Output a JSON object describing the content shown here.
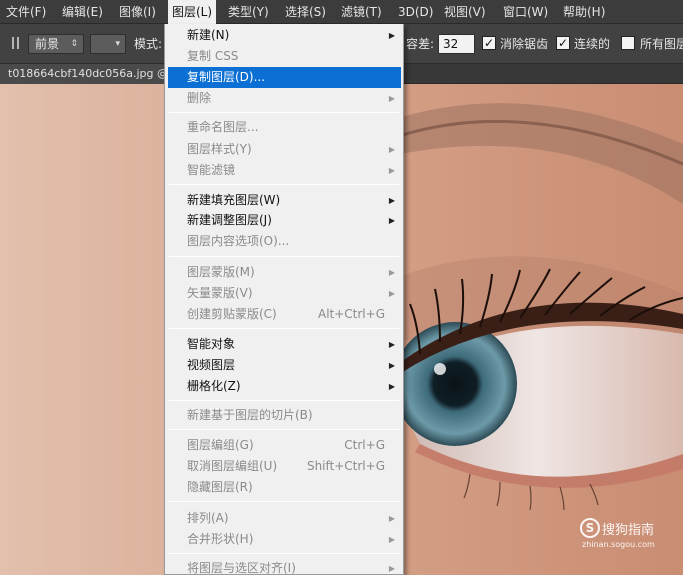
{
  "menubar": {
    "items": [
      "文件(F)",
      "编辑(E)",
      "图像(I)",
      "图层(L)",
      "类型(Y)",
      "选择(S)",
      "滤镜(T)",
      "3D(D)",
      "视图(V)",
      "窗口(W)",
      "帮助(H)"
    ]
  },
  "options": {
    "foreground": "前景",
    "swatch": "",
    "mode_label": "模式:",
    "tolerance_label": "容差:",
    "tolerance_value": "32",
    "antialias_label": "消除锯齿",
    "contiguous_label": "连续的",
    "all_layers_label": "所有图层"
  },
  "document": {
    "tab_title": "t018664cbf140dc056a.jpg @"
  },
  "layer_menu": {
    "new": "新建(N)",
    "copy_css": "复制 CSS",
    "duplicate_layer": "复制图层(D)...",
    "delete": "删除",
    "rename": "重命名图层...",
    "layer_style": "图层样式(Y)",
    "smart_filter": "智能滤镜",
    "new_fill": "新建填充图层(W)",
    "new_adjust": "新建调整图层(J)",
    "content_options": "图层内容选项(O)...",
    "layer_mask": "图层蒙版(M)",
    "vector_mask": "矢量蒙版(V)",
    "clipping_mask": "创建剪贴蒙版(C)",
    "clipping_mask_shortcut": "Alt+Ctrl+G",
    "smart_object": "智能对象",
    "video_layer": "视频图层",
    "rasterize": "栅格化(Z)",
    "slice": "新建基于图层的切片(B)",
    "group": "图层编组(G)",
    "group_shortcut": "Ctrl+G",
    "ungroup": "取消图层编组(U)",
    "ungroup_shortcut": "Shift+Ctrl+G",
    "hide": "隐藏图层(R)",
    "arrange": "排列(A)",
    "combine": "合并形状(H)",
    "align": "将图层与选区对齐(I)"
  },
  "watermark": {
    "logo": "S",
    "name": "搜狗指南",
    "url": "zhinan.sogou.com"
  },
  "colors": {
    "highlight": "#0b6fd3",
    "menu_bg": "#f0f0f0",
    "chrome": "#3c3c3c"
  }
}
